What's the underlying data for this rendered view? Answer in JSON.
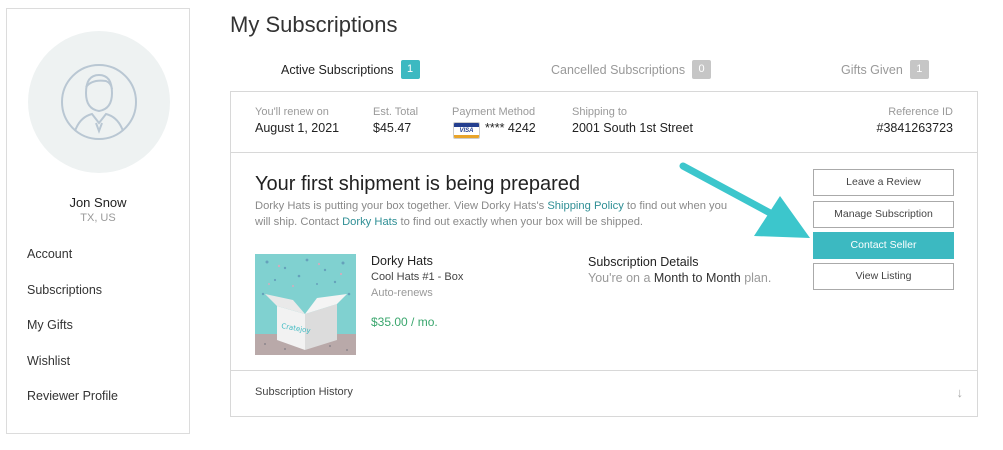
{
  "sidebar": {
    "user_name": "Jon Snow",
    "user_location": "TX, US",
    "nav": [
      "Account",
      "Subscriptions",
      "My Gifts",
      "Wishlist",
      "Reviewer Profile"
    ]
  },
  "page_title": "My Subscriptions",
  "tabs": [
    {
      "label": "Active Subscriptions",
      "count": "1"
    },
    {
      "label": "Cancelled Subscriptions",
      "count": "0"
    },
    {
      "label": "Gifts Given",
      "count": "1"
    }
  ],
  "subscription": {
    "renew_label": "You'll renew on",
    "renew_value": "August 1, 2021",
    "total_label": "Est. Total",
    "total_value": "$45.47",
    "payment_label": "Payment Method",
    "payment_value": "**** 4242",
    "card_brand": "VISA",
    "shipping_label": "Shipping to",
    "shipping_value": "2001 South 1st Street",
    "reference_label": "Reference ID",
    "reference_value": "#3841263723"
  },
  "shipment": {
    "title": "Your first shipment is being prepared",
    "desc_1": "Dorky Hats is putting your box together. View Dorky Hats's ",
    "desc_link_1": "Shipping Policy",
    "desc_2": " to find out when you",
    "desc_3": "will ship. Contact ",
    "desc_link_2": "Dorky Hats",
    "desc_4": " to find out exactly when your box will be shipped."
  },
  "product": {
    "name": "Dorky Hats",
    "variant": "Cool Hats #1 - Box",
    "renew": "Auto-renews",
    "price": "$35.00 / mo.",
    "box_logo": "Cratejoy"
  },
  "details": {
    "title": "Subscription Details",
    "plan_prefix": "You're on a ",
    "plan_name": "Month to Month",
    "plan_suffix": " plan."
  },
  "buttons": {
    "leave_review": "Leave a Review",
    "manage": "Manage Subscription",
    "contact": "Contact Seller",
    "view_listing": "View Listing"
  },
  "history": {
    "label": "Subscription History",
    "arrow": "↓"
  },
  "colors": {
    "accent": "#3cb9c1",
    "price_green": "#3aa66d",
    "annotation_arrow": "#3cc6cc"
  }
}
